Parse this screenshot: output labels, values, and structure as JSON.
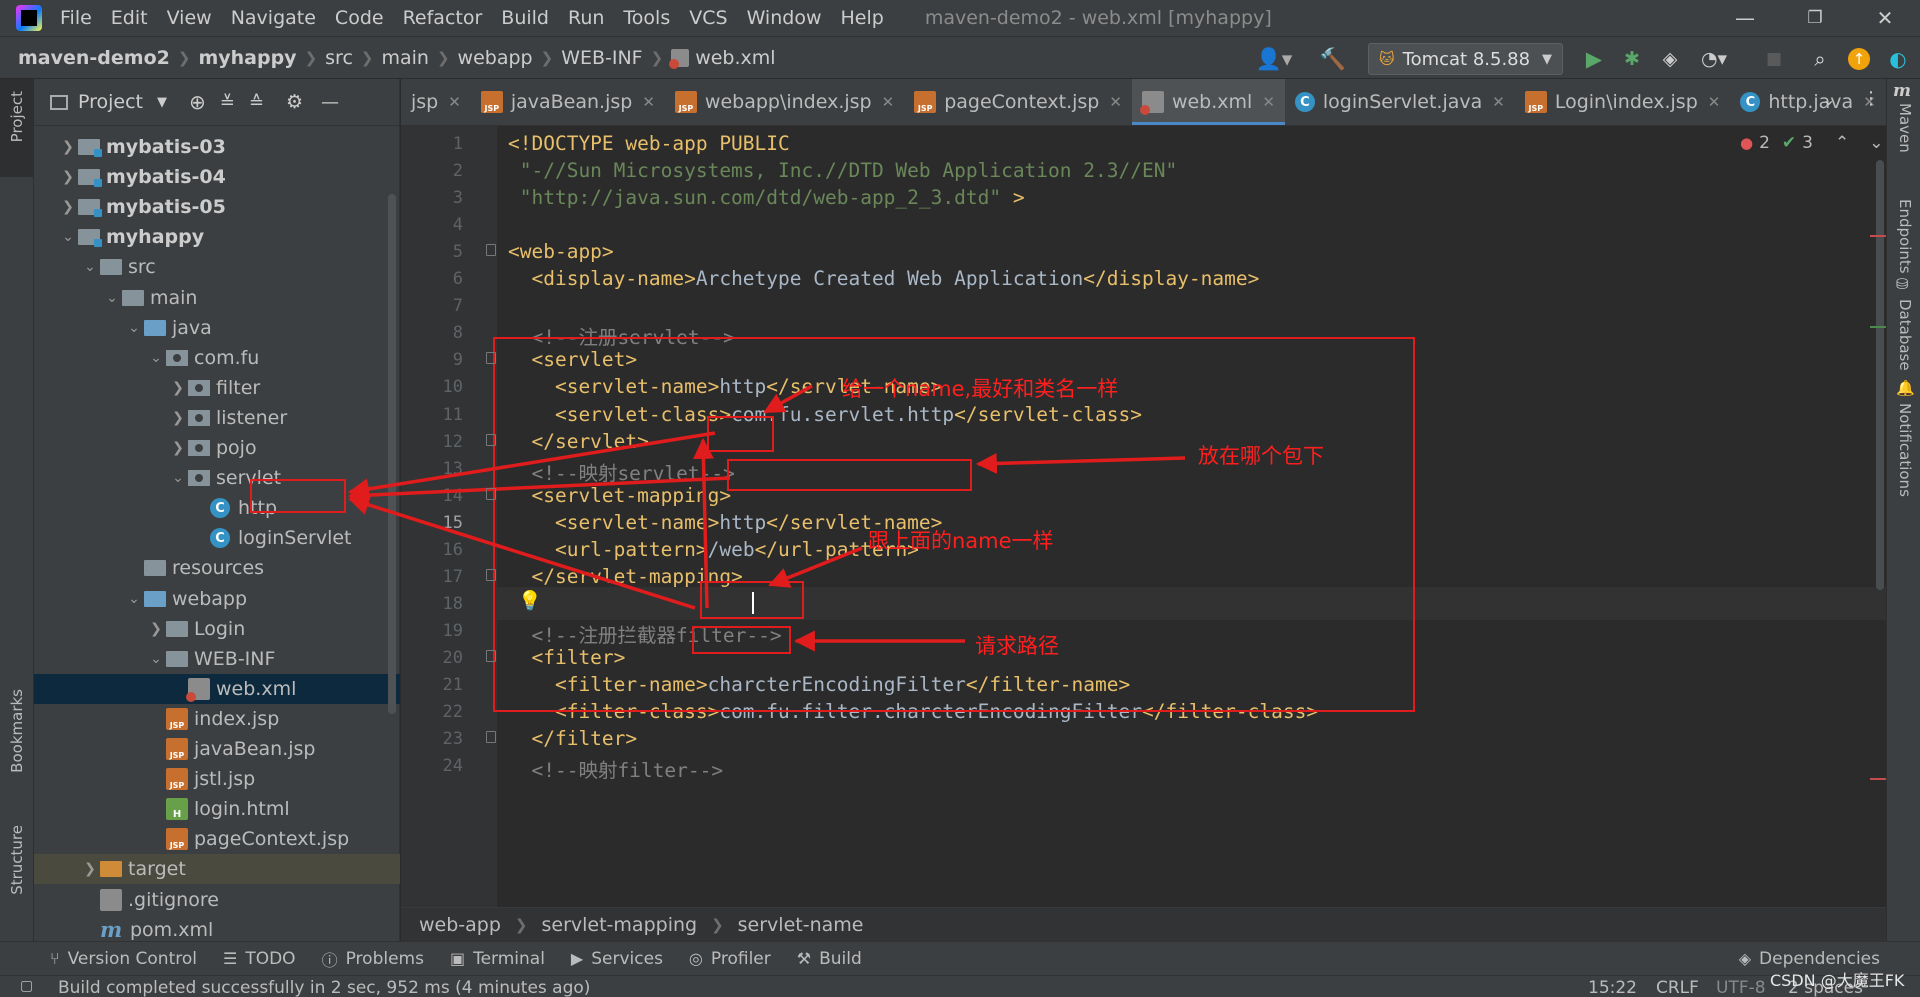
{
  "menu": {
    "items": [
      "File",
      "Edit",
      "View",
      "Navigate",
      "Code",
      "Refactor",
      "Build",
      "Run",
      "Tools",
      "VCS",
      "Window",
      "Help"
    ],
    "window_title": "maven-demo2 - web.xml [myhappy]"
  },
  "navbar": {
    "crumbs": [
      "maven-demo2",
      "myhappy",
      "src",
      "main",
      "webapp",
      "WEB-INF",
      "web.xml"
    ],
    "run_config": "Tomcat 8.5.88"
  },
  "project_panel": {
    "title": "Project",
    "rows": [
      {
        "label": "mybatis-03",
        "depth": 0,
        "arrow": "right",
        "icon": "module-folder",
        "bold": true
      },
      {
        "label": "mybatis-04",
        "depth": 0,
        "arrow": "right",
        "icon": "module-folder",
        "bold": true
      },
      {
        "label": "mybatis-05",
        "depth": 0,
        "arrow": "right",
        "icon": "module-folder",
        "bold": true
      },
      {
        "label": "myhappy",
        "depth": 0,
        "arrow": "down",
        "icon": "module-folder",
        "bold": true
      },
      {
        "label": "src",
        "depth": 1,
        "arrow": "down",
        "icon": "folder"
      },
      {
        "label": "main",
        "depth": 2,
        "arrow": "down",
        "icon": "folder"
      },
      {
        "label": "java",
        "depth": 3,
        "arrow": "down",
        "icon": "source-folder"
      },
      {
        "label": "com.fu",
        "depth": 4,
        "arrow": "down",
        "icon": "package"
      },
      {
        "label": "filter",
        "depth": 5,
        "arrow": "right",
        "icon": "package"
      },
      {
        "label": "listener",
        "depth": 5,
        "arrow": "right",
        "icon": "package"
      },
      {
        "label": "pojo",
        "depth": 5,
        "arrow": "right",
        "icon": "package"
      },
      {
        "label": "servlet",
        "depth": 5,
        "arrow": "down",
        "icon": "package"
      },
      {
        "label": "http",
        "depth": 6,
        "arrow": "none",
        "icon": "class"
      },
      {
        "label": "loginServlet",
        "depth": 6,
        "arrow": "none",
        "icon": "class"
      },
      {
        "label": "resources",
        "depth": 3,
        "arrow": "none",
        "icon": "folder"
      },
      {
        "label": "webapp",
        "depth": 3,
        "arrow": "down",
        "icon": "source-folder"
      },
      {
        "label": "Login",
        "depth": 4,
        "arrow": "right",
        "icon": "folder"
      },
      {
        "label": "WEB-INF",
        "depth": 4,
        "arrow": "down",
        "icon": "folder"
      },
      {
        "label": "web.xml",
        "depth": 5,
        "arrow": "none",
        "icon": "xml",
        "selected": true
      },
      {
        "label": "index.jsp",
        "depth": 4,
        "arrow": "none",
        "icon": "jsp"
      },
      {
        "label": "javaBean.jsp",
        "depth": 4,
        "arrow": "none",
        "icon": "jsp"
      },
      {
        "label": "jstl.jsp",
        "depth": 4,
        "arrow": "none",
        "icon": "jsp"
      },
      {
        "label": "login.html",
        "depth": 4,
        "arrow": "none",
        "icon": "html"
      },
      {
        "label": "pageContext.jsp",
        "depth": 4,
        "arrow": "none",
        "icon": "jsp"
      },
      {
        "label": "target",
        "depth": 1,
        "arrow": "right",
        "icon": "orange-folder",
        "target": true
      },
      {
        "label": ".gitignore",
        "depth": 1,
        "arrow": "none",
        "icon": "gitignore"
      },
      {
        "label": "pom.xml",
        "depth": 1,
        "arrow": "none",
        "icon": "maven"
      }
    ]
  },
  "tabs": [
    {
      "label": "jsp",
      "icon": "none"
    },
    {
      "label": "javaBean.jsp",
      "icon": "jsp"
    },
    {
      "label": "webapp\\index.jsp",
      "icon": "jsp"
    },
    {
      "label": "pageContext.jsp",
      "icon": "jsp"
    },
    {
      "label": "web.xml",
      "icon": "xml",
      "active": true
    },
    {
      "label": "loginServlet.java",
      "icon": "class"
    },
    {
      "label": "Login\\index.jsp",
      "icon": "jsp"
    },
    {
      "label": "http.java",
      "icon": "class"
    }
  ],
  "inspections": {
    "errors": "2",
    "ok": "3"
  },
  "code_lines": [
    [
      [
        "tag",
        "<!DOCTYPE web-app PUBLIC"
      ]
    ],
    [
      [
        "str",
        " \"-//Sun Microsystems, Inc.//DTD Web Application 2.3//EN\""
      ]
    ],
    [
      [
        "str",
        " \"http://java.sun.com/dtd/web-app_2_3.dtd\""
      ],
      [
        "tag",
        " >"
      ]
    ],
    [],
    [
      [
        "tag",
        "<web-app>"
      ]
    ],
    [
      [
        "tag",
        "  <display-name>"
      ],
      [
        "txt",
        "Archetype Created Web Application"
      ],
      [
        "tag",
        "</display-name>"
      ]
    ],
    [],
    [
      [
        "cmt",
        "  <!--注册servlet-->"
      ]
    ],
    [
      [
        "tag",
        "  <servlet>"
      ]
    ],
    [
      [
        "tag",
        "    <servlet-name>"
      ],
      [
        "txt",
        "http"
      ],
      [
        "tag",
        "</servlet-name>"
      ]
    ],
    [
      [
        "tag",
        "    <servlet-class>"
      ],
      [
        "txt",
        "com.fu.servlet.http"
      ],
      [
        "tag",
        "</servlet-class>"
      ]
    ],
    [
      [
        "tag",
        "  </servlet>"
      ]
    ],
    [
      [
        "cmt",
        "  <!--映射servlet-->"
      ]
    ],
    [
      [
        "tag",
        "  <servlet-mapping>"
      ]
    ],
    [
      [
        "tag",
        "    <servlet-name>"
      ],
      [
        "txt",
        "http"
      ],
      [
        "tag",
        "</servlet-name>"
      ]
    ],
    [
      [
        "tag",
        "    <url-pattern>"
      ],
      [
        "txt",
        "/web"
      ],
      [
        "tag",
        "</url-pattern>"
      ]
    ],
    [
      [
        "tag",
        "  </servlet-mapping>"
      ]
    ],
    [],
    [
      [
        "cmt",
        "  <!--注册拦截器filter-->"
      ]
    ],
    [
      [
        "tag",
        "  <filter>"
      ]
    ],
    [
      [
        "tag",
        "    <filter-name>"
      ],
      [
        "txt",
        "charcterEncodingFilter"
      ],
      [
        "tag",
        "</filter-name>"
      ]
    ],
    [
      [
        "tag",
        "    <filter-class>"
      ],
      [
        "txt",
        "com.fu.filter.charcterEncodingFilter"
      ],
      [
        "tag",
        "</filter-class>"
      ]
    ],
    [
      [
        "tag",
        "  </filter>"
      ]
    ],
    [
      [
        "cmt",
        "  <!--映射filter-->"
      ]
    ]
  ],
  "annotations": {
    "name_note": "给一个name,最好和类名一样",
    "package_note": "放在哪个包下",
    "same_note": "跟上面的name一样",
    "path_note": "请求路径"
  },
  "editor_breadcrumbs": [
    "web-app",
    "servlet-mapping",
    "servlet-name"
  ],
  "left_stripe": {
    "project": "Project",
    "bookmarks": "Bookmarks",
    "structure": "Structure"
  },
  "right_stripe": {
    "maven": "Maven",
    "endpoints": "Endpoints",
    "database": "Database",
    "notifications": "Notifications"
  },
  "tool_windows": [
    "Version Control",
    "TODO",
    "Problems",
    "Terminal",
    "Services",
    "Profiler",
    "Build"
  ],
  "tool_right": "Dependencies",
  "status": {
    "message": "Build completed successfully in 2 sec, 952 ms (4 minutes ago)",
    "position": "15:22",
    "line_sep": "CRLF",
    "encoding": "UTF-8",
    "indent": "2 spaces",
    "watermark": "CSDN @大魔王FK"
  },
  "colors": {
    "tag": "#e8bf6a",
    "string": "#6a8759",
    "comment": "#808080",
    "annotation": "#ff1f1f",
    "selection": "#0d293e"
  }
}
